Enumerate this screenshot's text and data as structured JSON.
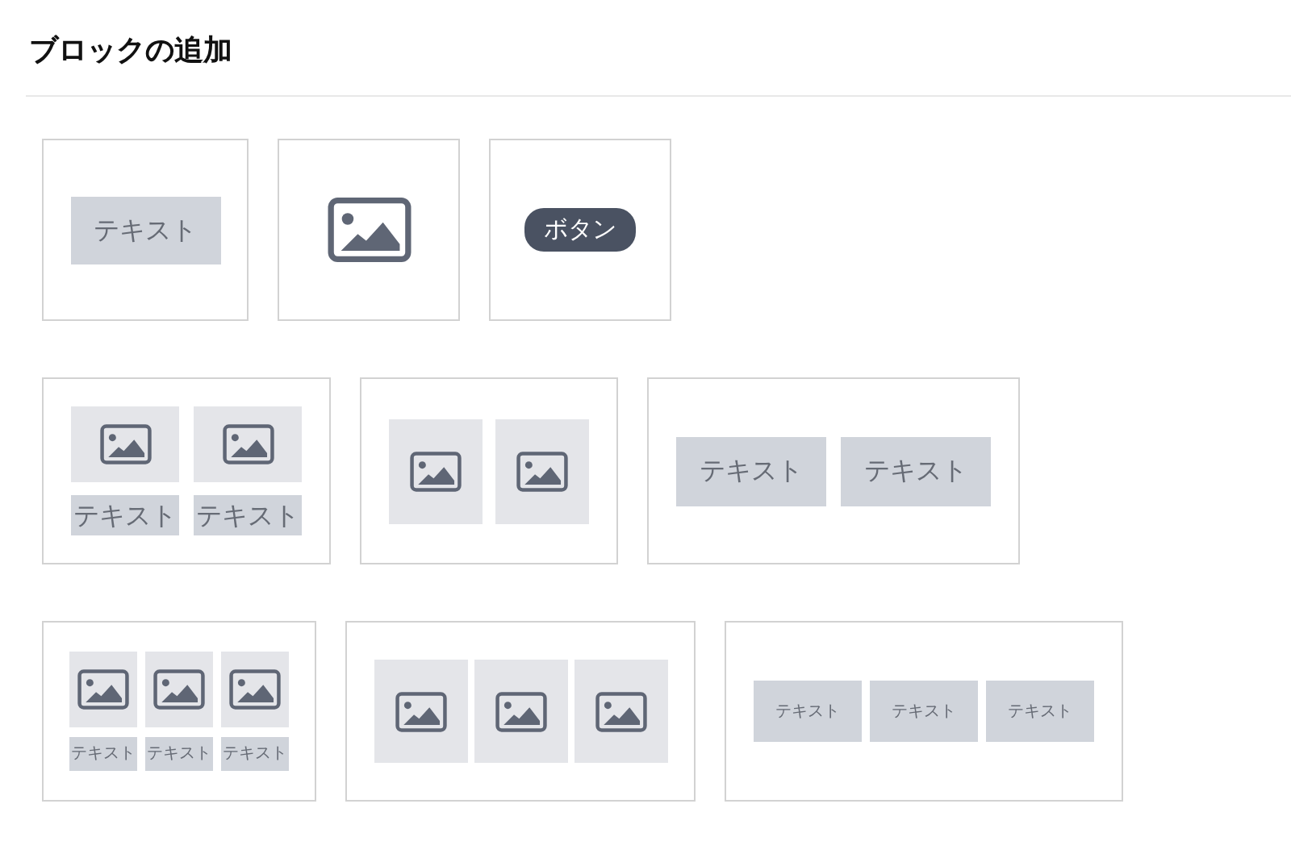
{
  "title": "ブロックの追加",
  "rows": [
    {
      "blocks": [
        {
          "kind": "text",
          "cells": [
            {
              "label": "テキスト"
            }
          ]
        },
        {
          "kind": "image",
          "cells": [
            {}
          ]
        },
        {
          "kind": "button",
          "cells": [
            {
              "label": "ボタン"
            }
          ]
        }
      ]
    },
    {
      "blocks": [
        {
          "kind": "image-text",
          "cells": [
            {
              "label": "テキスト"
            },
            {
              "label": "テキスト"
            }
          ]
        },
        {
          "kind": "image",
          "cells": [
            {},
            {}
          ]
        },
        {
          "kind": "text",
          "cells": [
            {
              "label": "テキスト"
            },
            {
              "label": "テキスト"
            }
          ]
        }
      ]
    },
    {
      "blocks": [
        {
          "kind": "image-text",
          "cells": [
            {
              "label": "テキスト"
            },
            {
              "label": "テキスト"
            },
            {
              "label": "テキスト"
            }
          ]
        },
        {
          "kind": "image",
          "cells": [
            {},
            {},
            {}
          ]
        },
        {
          "kind": "text",
          "cells": [
            {
              "label": "テキスト"
            },
            {
              "label": "テキスト"
            },
            {
              "label": "テキスト"
            }
          ]
        }
      ]
    }
  ]
}
